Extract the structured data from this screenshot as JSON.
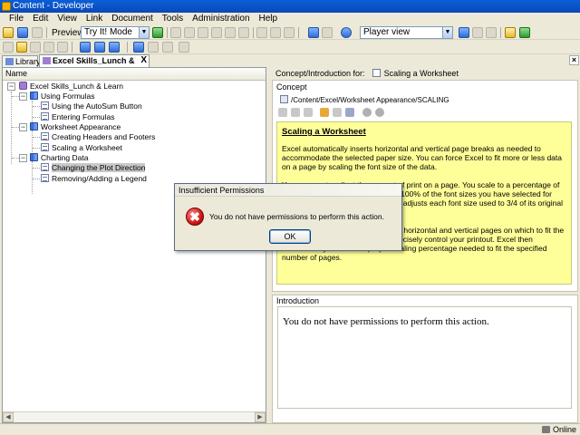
{
  "window": {
    "title": "Content - Developer"
  },
  "menu": [
    "File",
    "Edit",
    "View",
    "Link",
    "Document",
    "Tools",
    "Administration",
    "Help"
  ],
  "toolbar": {
    "preview_label": "Preview:",
    "preview_mode": "Try It! Mode",
    "view_mode": "Player view"
  },
  "tabs": [
    {
      "label": "Library"
    },
    {
      "label": "Excel Skills_Lunch & Learn",
      "close": "X"
    }
  ],
  "outline": {
    "column_header": "Name",
    "nodes": [
      {
        "label": "Excel Skills_Lunch & Learn",
        "type": "root"
      },
      {
        "label": "Using Formulas",
        "type": "book"
      },
      {
        "label": "Using the AutoSum Button",
        "type": "doc"
      },
      {
        "label": "Entering Formulas",
        "type": "doc"
      },
      {
        "label": "Worksheet Appearance",
        "type": "book"
      },
      {
        "label": "Creating Headers and Footers",
        "type": "doc"
      },
      {
        "label": "Scaling a Worksheet",
        "type": "doc"
      },
      {
        "label": "Charting Data",
        "type": "book"
      },
      {
        "label": "Changing the Plot Direction",
        "type": "doc",
        "selected": true
      },
      {
        "label": "Removing/Adding a Legend",
        "type": "doc"
      }
    ]
  },
  "concept": {
    "header_label": "Concept/Introduction for:",
    "header_item": "Scaling a Worksheet",
    "section_title": "Concept",
    "path": "/Content/Excel/Worksheet Appearance/SCALING",
    "heading": "Scaling a Worksheet",
    "p1": "Excel automatically inserts horizontal and vertical page breaks as needed to accommodate the selected paper size. You can force Excel to fit more or less data on a page by scaling the font size of the data.",
    "p2": "You can use to adjust the amount of print on a page. You scale to a percentage of its original size. The default size is 100% of the font sizes you have selected for your data. By choosing 75%, Excel adjusts each font size used to 3/4 of its original size.",
    "p3": "You can also specify the number of horizontal and vertical pages on which to fit the data. With this method, you can precisely control your printout. Excel then automatically selects the proper scaling percentage needed to fit the specified number of pages."
  },
  "introduction": {
    "section_title": "Introduction",
    "text": "You do not have permissions to perform this action."
  },
  "status": {
    "text": "Online"
  },
  "dialog": {
    "title": "Insufficient Permissions",
    "message": "You do not have permissions to perform this action.",
    "ok_label": "OK",
    "icon_glyph": "✖"
  }
}
